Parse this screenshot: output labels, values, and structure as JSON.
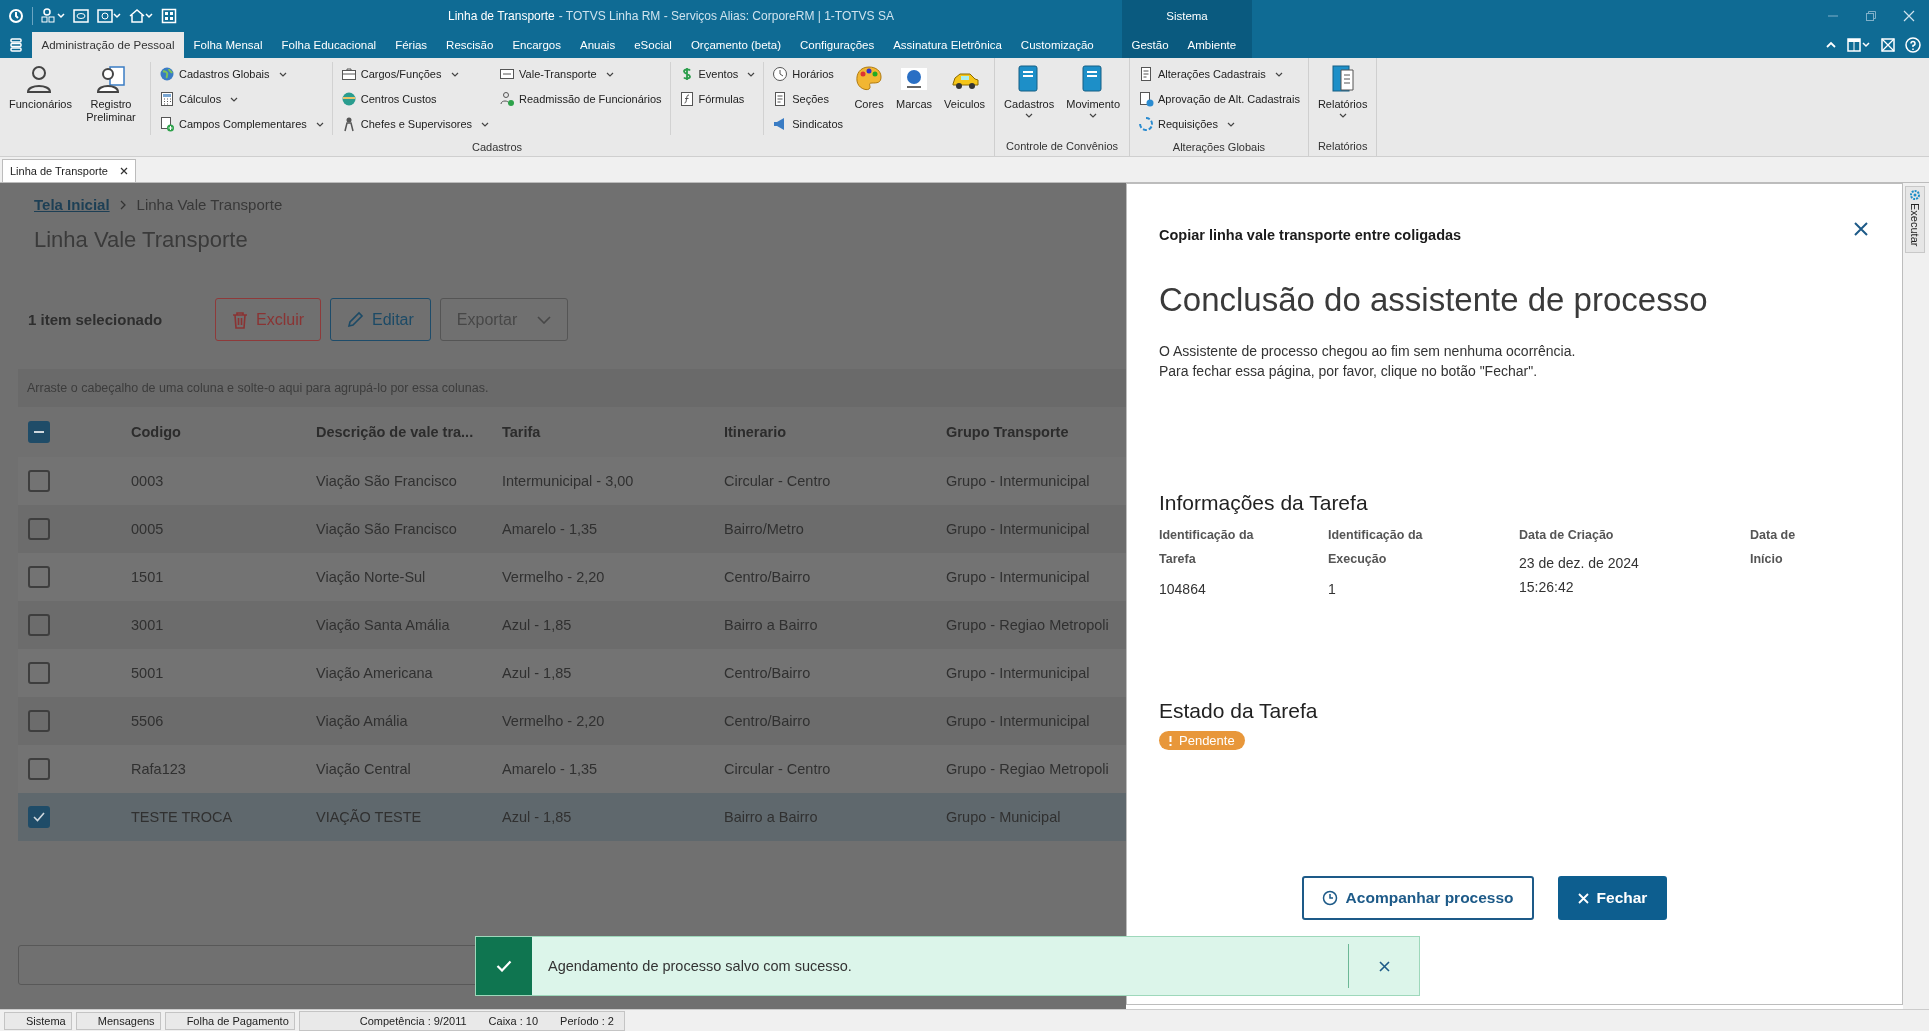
{
  "window": {
    "title": "Linha de Transporte",
    "subtitle": "- TOTVS Linha RM - Serviços  Alias: CorporeRM | 1-TOTVS SA"
  },
  "ribbon_tabs": [
    {
      "label": "Administração de Pessoal",
      "selected": true
    },
    {
      "label": "Folha Mensal",
      "selected": false
    },
    {
      "label": "Folha Educacional",
      "selected": false
    },
    {
      "label": "Férias",
      "selected": false
    },
    {
      "label": "Rescisão",
      "selected": false
    },
    {
      "label": "Encargos",
      "selected": false
    },
    {
      "label": "Anuais",
      "selected": false
    },
    {
      "label": "eSocial",
      "selected": false
    },
    {
      "label": "Orçamento (beta)",
      "selected": false
    },
    {
      "label": "Configurações",
      "selected": false
    },
    {
      "label": "Assinatura Eletrônica",
      "selected": false
    },
    {
      "label": "Customização",
      "selected": false
    }
  ],
  "context_group": {
    "label": "Sistema",
    "tabs": [
      {
        "label": "Gestão",
        "selected": false
      },
      {
        "label": "Ambiente",
        "selected": false
      }
    ]
  },
  "ribbon_groups": [
    {
      "label": "Cadastros",
      "sections": [
        [
          {
            "kind": "large",
            "label": "Funcionários",
            "dropdown": false
          },
          {
            "kind": "large",
            "label": "Registro Preliminar",
            "dropdown": false
          }
        ],
        [
          {
            "kind": "column",
            "items": [
              {
                "label": "Cadastros Globais",
                "dropdown": true
              },
              {
                "label": "Cálculos",
                "dropdown": true
              },
              {
                "label": "Campos Complementares",
                "dropdown": true
              }
            ]
          }
        ],
        [
          {
            "kind": "column",
            "items": [
              {
                "label": "Cargos/Funções",
                "dropdown": true
              },
              {
                "label": "Centros Custos",
                "dropdown": false
              },
              {
                "label": "Chefes e Supervisores",
                "dropdown": true
              }
            ]
          },
          {
            "kind": "column",
            "items": [
              {
                "label": "Vale-Transporte",
                "dropdown": true
              },
              {
                "label": "Readmissão de Funcionários",
                "dropdown": false
              }
            ]
          }
        ],
        [
          {
            "kind": "column",
            "items": [
              {
                "label": "Eventos",
                "dropdown": true
              },
              {
                "label": "Fórmulas",
                "dropdown": false
              }
            ]
          }
        ],
        [
          {
            "kind": "column",
            "items": [
              {
                "label": "Horários",
                "dropdown": false
              },
              {
                "label": "Seções",
                "dropdown": false
              },
              {
                "label": "Sindicatos",
                "dropdown": false
              }
            ]
          },
          {
            "kind": "large",
            "label": "Cores",
            "dropdown": false
          },
          {
            "kind": "large",
            "label": "Marcas",
            "dropdown": false
          },
          {
            "kind": "large",
            "label": "Veiculos",
            "dropdown": false
          }
        ]
      ]
    },
    {
      "label": "Controle de Convênios",
      "sections": [
        [
          {
            "kind": "large",
            "label": "Cadastros",
            "dropdown": true
          },
          {
            "kind": "large",
            "label": "Movimento",
            "dropdown": true
          }
        ]
      ]
    },
    {
      "label": "Alterações Globais",
      "sections": [
        [
          {
            "kind": "column",
            "items": [
              {
                "label": "Alterações Cadastrais",
                "dropdown": true
              },
              {
                "label": "Aprovação de Alt. Cadastrais",
                "dropdown": false
              },
              {
                "label": "Requisições",
                "dropdown": true
              }
            ]
          }
        ]
      ]
    },
    {
      "label": "Relatórios",
      "sections": [
        [
          {
            "kind": "large",
            "label": "Relatórios",
            "dropdown": true
          }
        ]
      ]
    }
  ],
  "document_tabs": [
    {
      "label": "Linha de Transporte",
      "selected": true
    }
  ],
  "breadcrumb": {
    "link": "Tela Inicial",
    "current": "Linha Vale Transporte"
  },
  "page_title": "Linha Vale Transporte",
  "toolbar": {
    "selection_text": "1 item selecionado",
    "buttons": [
      {
        "label": "Excluir",
        "kind": "danger",
        "disabled": false
      },
      {
        "label": "Editar",
        "kind": "edit",
        "disabled": false
      },
      {
        "label": "Exportar",
        "kind": "export",
        "disabled": true
      }
    ]
  },
  "group_hint": "Arraste o cabeçalho de uma coluna e solte-o aqui para agrupá-lo por essa colunas.",
  "table": {
    "select_all": {
      "indeterminate": true
    },
    "columns": [
      "Codigo",
      "Descrição de vale tra...",
      "Tarifa",
      "Itinerario",
      "Grupo Transporte"
    ],
    "rows": [
      {
        "selected": false,
        "cells": [
          "0003",
          "Viação São Francisco",
          "Intermunicipal - 3,00",
          "Circular - Centro",
          "Grupo - Intermunicipal"
        ]
      },
      {
        "selected": false,
        "cells": [
          "0005",
          "Viação São Francisco",
          "Amarelo - 1,35",
          "Bairro/Metro",
          "Grupo - Intermunicipal"
        ]
      },
      {
        "selected": false,
        "cells": [
          "1501",
          "Viação Norte-Sul",
          "Vermelho - 2,20",
          "Centro/Bairro",
          "Grupo - Intermunicipal"
        ]
      },
      {
        "selected": false,
        "cells": [
          "3001",
          "Viação Santa Amália",
          "Azul - 1,85",
          "Bairro a Bairro",
          "Grupo - Regiao Metropoli"
        ]
      },
      {
        "selected": false,
        "cells": [
          "5001",
          "Viação Americana",
          "Azul - 1,85",
          "Centro/Bairro",
          "Grupo - Intermunicipal"
        ]
      },
      {
        "selected": false,
        "cells": [
          "5506",
          "Viação Amália",
          "Vermelho - 2,20",
          "Centro/Bairro",
          "Grupo - Intermunicipal"
        ]
      },
      {
        "selected": false,
        "cells": [
          "Rafa123",
          "Viação Central",
          "Amarelo - 1,35",
          "Circular - Centro",
          "Grupo - Regiao Metropoli"
        ]
      },
      {
        "selected": true,
        "cells": [
          "TESTE TROCA",
          "VIAÇÃO TESTE",
          "Azul - 1,85",
          "Bairro a Bairro",
          "Grupo - Municipal"
        ]
      }
    ]
  },
  "panel": {
    "title": "Copiar linha vale transporte entre coligadas",
    "heading": "Conclusão do assistente de processo",
    "message_lines": [
      "O Assistente de processo chegou ao fim sem nenhuma ocorrência.",
      "Para fechar essa página, por favor, clique no botão \"Fechar\"."
    ],
    "info_title": "Informações da Tarefa",
    "fields": [
      {
        "label": "Identificação da Tarefa",
        "value": "104864"
      },
      {
        "label": "Identificação da Execução",
        "value": "1"
      },
      {
        "label": "Data de Criação",
        "value": "23 de dez. de 2024 15:26:42"
      },
      {
        "label": "Data de Início"
      }
    ],
    "status_title": "Estado da Tarefa",
    "status": {
      "label": "Pendente",
      "kind": "warning"
    },
    "buttons": [
      {
        "label": "Acompanhar processo",
        "kind": "secondary"
      },
      {
        "label": "Fechar",
        "kind": "primary"
      }
    ]
  },
  "side_tab": "Executar",
  "toast": {
    "kind": "success",
    "message": "Agendamento de processo salvo com sucesso."
  },
  "status_bar": {
    "buttons": [
      "Sistema",
      "Mensagens",
      "Folha de Pagamento"
    ],
    "info": [
      "Competência : 9/2011",
      "Caixa : 10",
      "Período : 2"
    ]
  }
}
